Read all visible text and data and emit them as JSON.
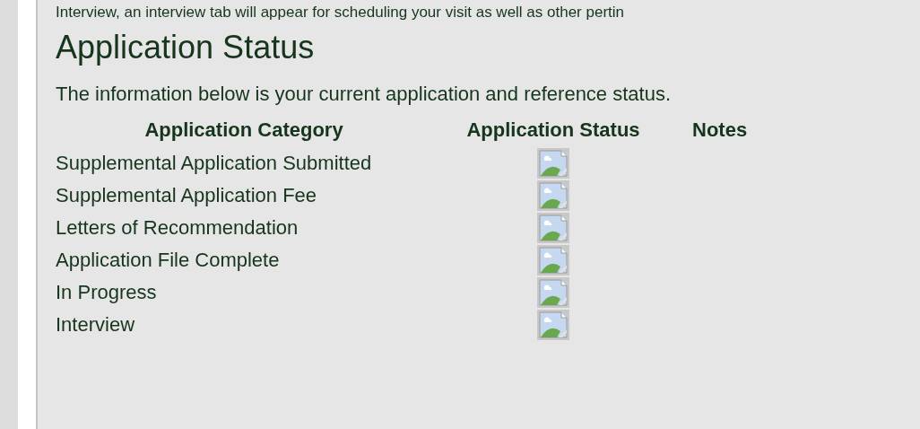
{
  "intro_text": "Interview, an interview tab will appear for scheduling your visit as well as other pertin",
  "heading": "Application Status",
  "description": "The information below is your current application and reference status.",
  "table": {
    "columns": [
      "Application Category",
      "Application Status",
      "Notes"
    ],
    "rows": [
      {
        "category": "Supplemental Application Submitted"
      },
      {
        "category": "Supplemental Application Fee"
      },
      {
        "category": "Letters of Recommendation"
      },
      {
        "category": "Application File Complete"
      },
      {
        "category": "In Progress"
      },
      {
        "category": "Interview"
      }
    ]
  }
}
